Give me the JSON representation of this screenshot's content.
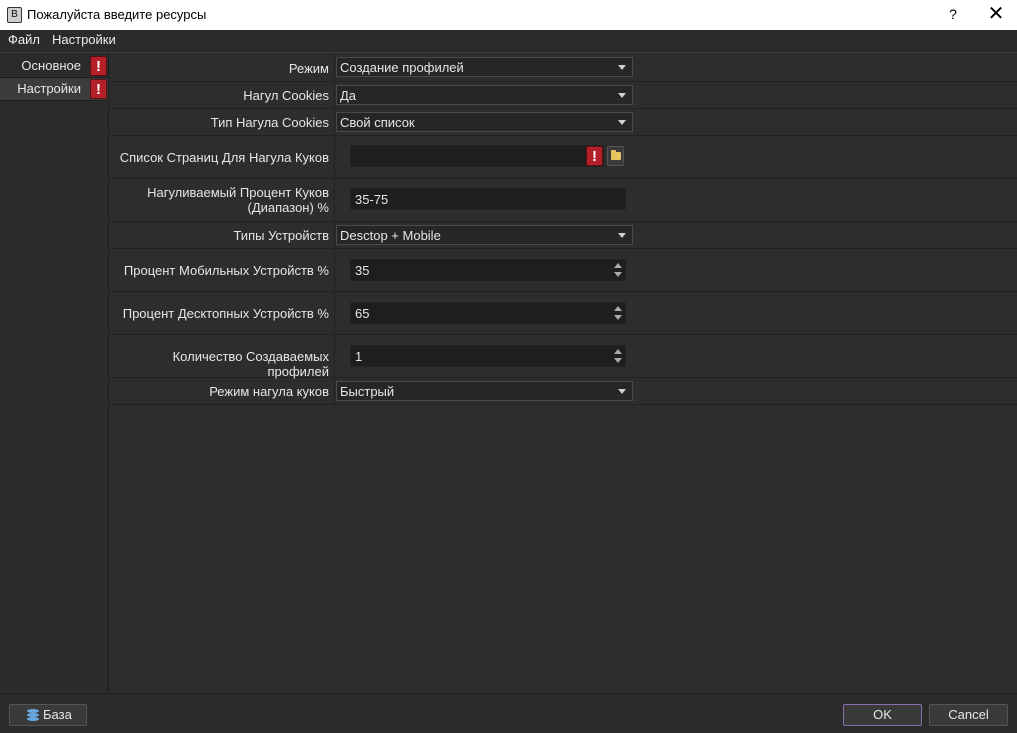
{
  "window": {
    "icon_letter": "B",
    "title": "Пожалуйста введите ресурсы",
    "help": "?",
    "close": "✕"
  },
  "menu": {
    "file": "Файл",
    "settings": "Настройки"
  },
  "sidebar": {
    "items": [
      {
        "label": "Основное"
      },
      {
        "label": "Настройки"
      }
    ]
  },
  "warning_glyph": "!",
  "form": {
    "mode": {
      "label": "Режим",
      "value": "Создание профилей"
    },
    "cookies": {
      "label": "Нагул Cookies",
      "value": "Да"
    },
    "cookies_type": {
      "label": "Тип Нагула Cookies",
      "value": "Свой список"
    },
    "pages_list": {
      "label": "Список Страниц Для Нагула Куков",
      "value": ""
    },
    "cookie_percent": {
      "label_line1": "Нагуливаемый Процент Куков",
      "label_line2": "(Диапазон) %",
      "value": "35-75"
    },
    "device_types": {
      "label": "Типы Устройств",
      "value": "Desctop + Mobile"
    },
    "mobile_percent": {
      "label": "Процент Мобильных Устройств %",
      "value": "35"
    },
    "desktop_percent": {
      "label": "Процент Десктопных Устройств %",
      "value": "65"
    },
    "profiles_count": {
      "label": "Количество Создаваемых профилей",
      "value": "1"
    },
    "cookie_mode": {
      "label": "Режим нагула куков",
      "value": "Быстрый"
    }
  },
  "buttons": {
    "base": "База",
    "ok": "OK",
    "cancel": "Cancel"
  },
  "colors": {
    "background": "#2d2d2d",
    "warning": "#b3202a",
    "ok_border": "#8a6fb0"
  }
}
